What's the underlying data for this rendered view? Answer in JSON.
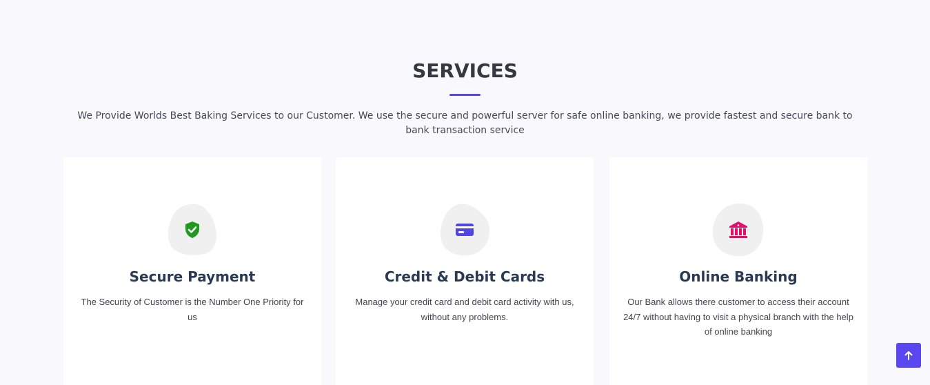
{
  "section": {
    "title": "SERVICES",
    "description": "We Provide Worlds Best Baking Services to our Customer. We use the secure and powerful server for safe online banking, we provide fastest and secure bank to bank transaction service"
  },
  "services": [
    {
      "title": "Secure Payment",
      "description": "The Security of Customer is the Number One Priority for us",
      "icon": "shield-check-icon",
      "color": "#1f9a1f"
    },
    {
      "title": "Credit & Debit Cards",
      "description": "Manage your credit card and debit card activity with us, without any problems.",
      "icon": "credit-card-icon",
      "color": "#4f46e5"
    },
    {
      "title": "Online Banking",
      "description": "Our Bank allows there customer to access their account 24/7 without having to visit a physical branch with the help of online banking",
      "icon": "bank-icon",
      "color": "#e0106a"
    }
  ],
  "colors": {
    "accent": "#5b47e0",
    "background": "#f8f8fd",
    "heading": "#37373f",
    "card_title": "#2a3a55"
  },
  "back_to_top": {
    "icon": "arrow-up-icon",
    "color": "#5b47f0"
  }
}
